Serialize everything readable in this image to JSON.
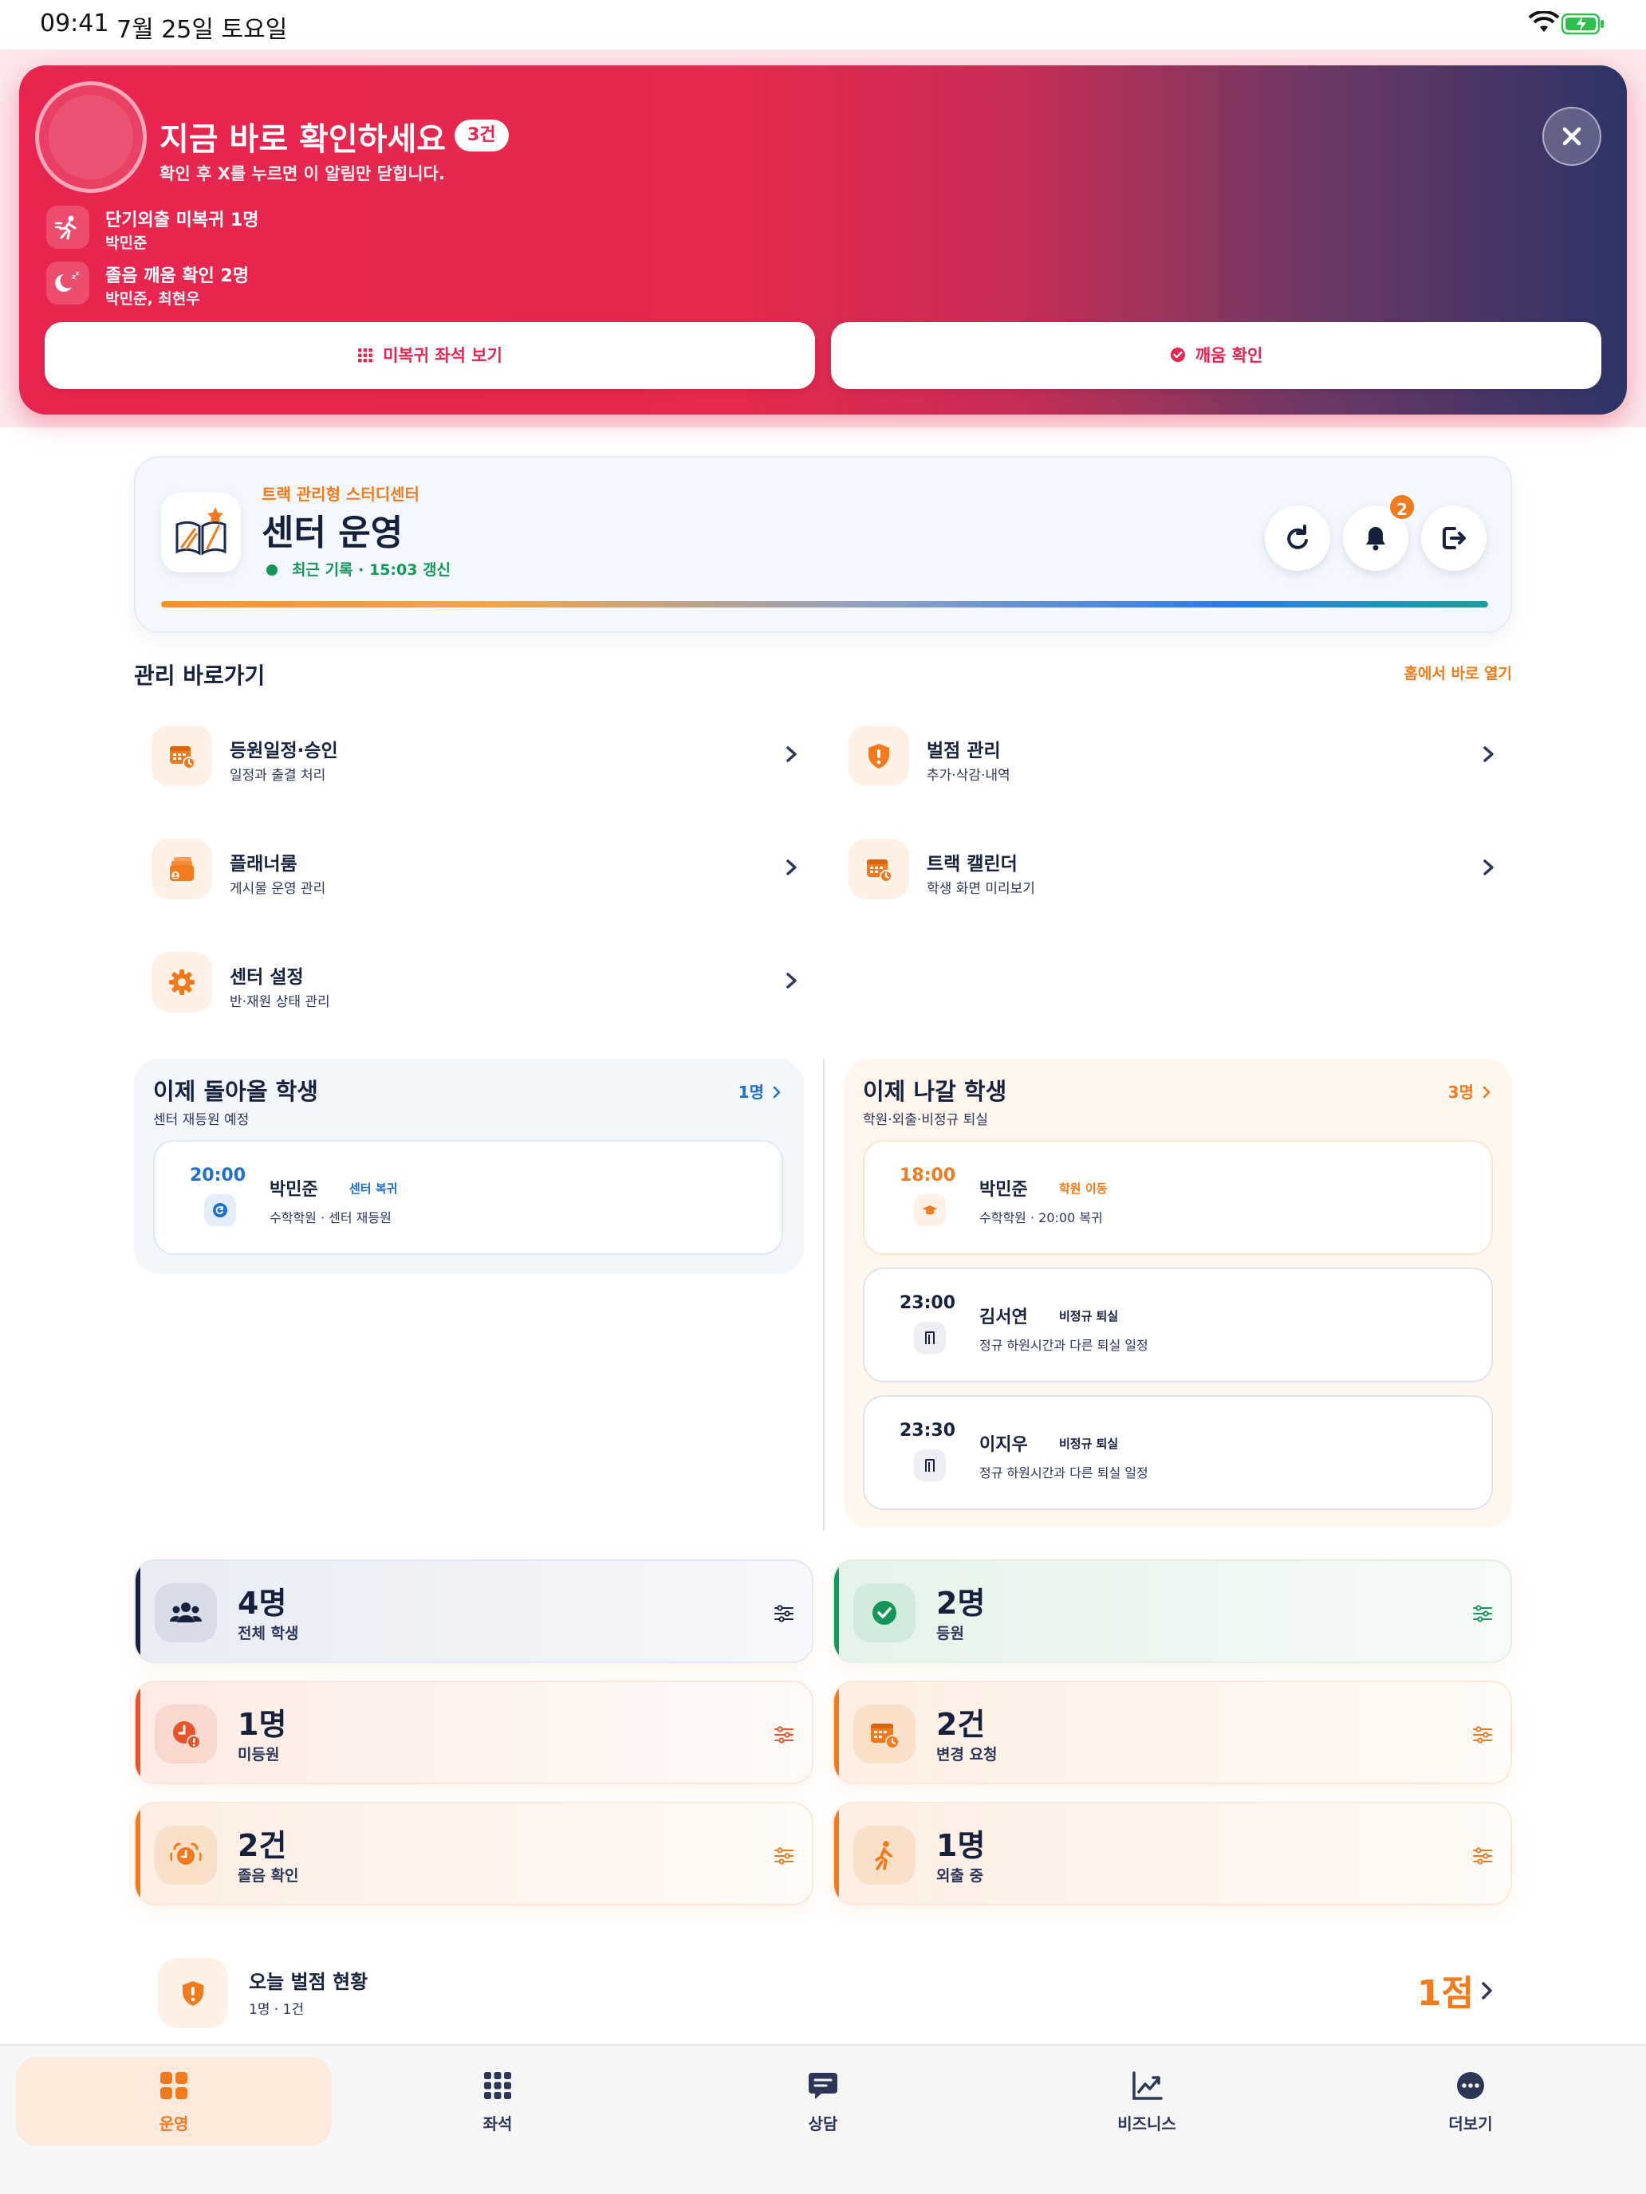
{
  "status_bar": {
    "time": "09:41",
    "date": "7월 25일 토요일"
  },
  "banner": {
    "title": "지금 바로 확인하세요",
    "count_badge": "3건",
    "subtitle": "확인 후 X를 누르면 이 알림만 닫힙니다.",
    "alerts": [
      {
        "icon": "running-person-icon",
        "title": "단기외출 미복귀 1명",
        "names": "박민준"
      },
      {
        "icon": "moon-sleep-icon",
        "title": "졸음 깨움 확인 2명",
        "names": "박민준, 최현우"
      }
    ],
    "actions": [
      {
        "icon": "grid-icon",
        "label": "미복귀 좌석 보기"
      },
      {
        "icon": "check-circle-icon",
        "label": "깨움 확인"
      }
    ]
  },
  "header": {
    "eyebrow": "트랙 관리형 스터디센터",
    "title": "센터 운영",
    "sync_text": "최근 기록 · 15:03 갱신",
    "notification_count": "2",
    "progress": 1.0,
    "buttons": [
      "refresh-icon",
      "bell-icon",
      "logout-icon"
    ]
  },
  "quick": {
    "title": "관리 바로가기",
    "link": "홈에서 바로 열기",
    "items": [
      {
        "icon": "calendar-clock-icon",
        "title": "등원일정·승인",
        "sub": "일정과 출결 처리"
      },
      {
        "icon": "shield-alert-icon",
        "title": "벌점 관리",
        "sub": "추가·삭감·내역"
      },
      {
        "icon": "planner-stack-icon",
        "title": "플래너룸",
        "sub": "게시물 운영 관리"
      },
      {
        "icon": "calendar-icon",
        "title": "트랙 캘린더",
        "sub": "학생 화면 미리보기"
      },
      {
        "icon": "gear-icon",
        "title": "센터 설정",
        "sub": "반·재원 상태 관리"
      }
    ]
  },
  "returning": {
    "title": "이제 돌아올 학생",
    "sub": "센터 재등원 예정",
    "count": "1명",
    "entries": [
      {
        "time": "20:00",
        "name": "박민준",
        "tag": "센터 복귀",
        "desc": "수학학원 · 센터 재등원"
      }
    ]
  },
  "leaving": {
    "title": "이제 나갈 학생",
    "sub": "학원·외출·비정규 퇴실",
    "count": "3명",
    "entries": [
      {
        "time": "18:00",
        "name": "박민준",
        "tag": "학원 이동",
        "desc": "수학학원 · 20:00 복귀"
      },
      {
        "time": "23:00",
        "name": "김서연",
        "tag": "비정규 퇴실",
        "desc": "정규 하원시간과 다른 퇴실 일정"
      },
      {
        "time": "23:30",
        "name": "이지우",
        "tag": "비정규 퇴실",
        "desc": "정규 하원시간과 다른 퇴실 일정"
      }
    ]
  },
  "stats": [
    {
      "value": "4명",
      "label": "전체 학생",
      "icon": "users-icon",
      "accent": "#16213e"
    },
    {
      "value": "2명",
      "label": "등원",
      "icon": "check-circle-icon",
      "accent": "#15975a"
    },
    {
      "value": "1명",
      "label": "미등원",
      "icon": "clock-alert-icon",
      "accent": "#e8542a"
    },
    {
      "value": "2건",
      "label": "변경 요청",
      "icon": "calendar-clock-icon",
      "accent": "#f07a1c"
    },
    {
      "value": "2건",
      "label": "졸음 확인",
      "icon": "alarm-clock-icon",
      "accent": "#f07a1c"
    },
    {
      "value": "1명",
      "label": "외출 중",
      "icon": "walking-person-icon",
      "accent": "#f07a1c"
    }
  ],
  "penalty": {
    "title": "오늘 벌점 현황",
    "sub": "1명 · 1건",
    "value": "1점"
  },
  "tabs": [
    {
      "icon": "dashboard-icon",
      "label": "운영",
      "active": true
    },
    {
      "icon": "seat-grid-icon",
      "label": "좌석",
      "active": false
    },
    {
      "icon": "chat-icon",
      "label": "상담",
      "active": false
    },
    {
      "icon": "chart-icon",
      "label": "비즈니스",
      "active": false
    },
    {
      "icon": "more-icon",
      "label": "더보기",
      "active": false
    }
  ],
  "colors": {
    "brand_orange": "#f07a1c",
    "alert_red": "#e8254f",
    "navy": "#16213e",
    "green": "#15975a",
    "blue": "#1d6fd0"
  }
}
